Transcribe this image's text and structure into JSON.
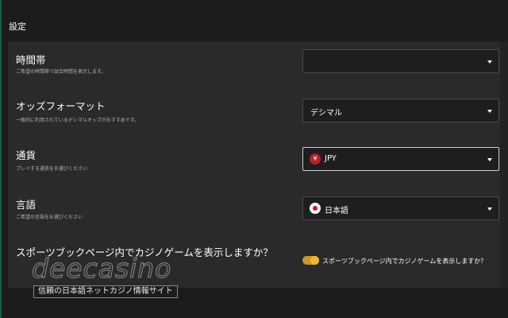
{
  "page": {
    "title": "設定"
  },
  "settings": {
    "timezone": {
      "title": "時間帯",
      "description": "ご希望の時間帯で試合時間を表示します。",
      "value": ""
    },
    "odds_format": {
      "title": "オッズフォーマット",
      "description": "一般的に利用されているデシマルオッズがおすすめです。",
      "value": "デシマル"
    },
    "currency": {
      "title": "通貨",
      "description": "プレイする通貨をお選びください",
      "value": "JPY",
      "flag_symbol": "¥",
      "flag_color": "#b4212e"
    },
    "language": {
      "title": "言語",
      "description": "ご希望の言語をお選びください",
      "value": "日本語",
      "flag_icon": "japan-flag-icon"
    },
    "casino_games": {
      "title": "スポーツブックページ内でカジノゲームを表示しますか？",
      "toggle_label": "スポーツブックページ内でカジノゲームを表示しますか？",
      "toggle_on": true,
      "accent_color": "#f0b63c"
    }
  },
  "watermark": {
    "logo_text": "deecasino",
    "badge_text": "信頼の日本語ネットカジノ情報サイト"
  }
}
